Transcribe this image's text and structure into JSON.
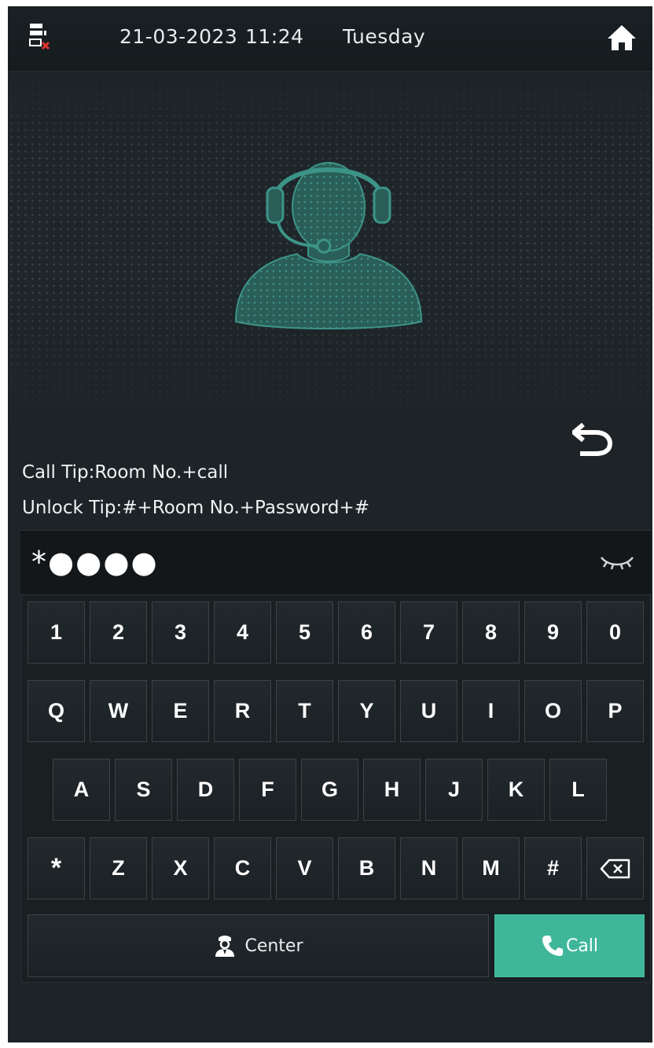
{
  "statusbar": {
    "date": "21-03-2023",
    "time": "11:24",
    "weekday": "Tuesday",
    "network_icon": "network-disconnected-icon",
    "home_icon": "home-icon"
  },
  "tips": {
    "call": "Call Tip:Room No.+call",
    "unlock": "Unlock Tip:#+Room No.+Password+#"
  },
  "password": {
    "value": "*●●●●",
    "toggle_icon": "eye-closed-icon"
  },
  "keypad": {
    "rows": [
      [
        "1",
        "2",
        "3",
        "4",
        "5",
        "6",
        "7",
        "8",
        "9",
        "0"
      ],
      [
        "Q",
        "W",
        "E",
        "R",
        "T",
        "Y",
        "U",
        "I",
        "O",
        "P"
      ],
      [
        "A",
        "S",
        "D",
        "F",
        "G",
        "H",
        "J",
        "K",
        "L"
      ],
      [
        "*",
        "Z",
        "X",
        "C",
        "V",
        "B",
        "N",
        "M",
        "#"
      ]
    ],
    "backspace_icon": "backspace-icon",
    "center_label": "Center",
    "call_label": "Call"
  },
  "colors": {
    "accent": "#3fb69a",
    "background": "#1d2327",
    "agent_illustration": "#2f6f68"
  }
}
